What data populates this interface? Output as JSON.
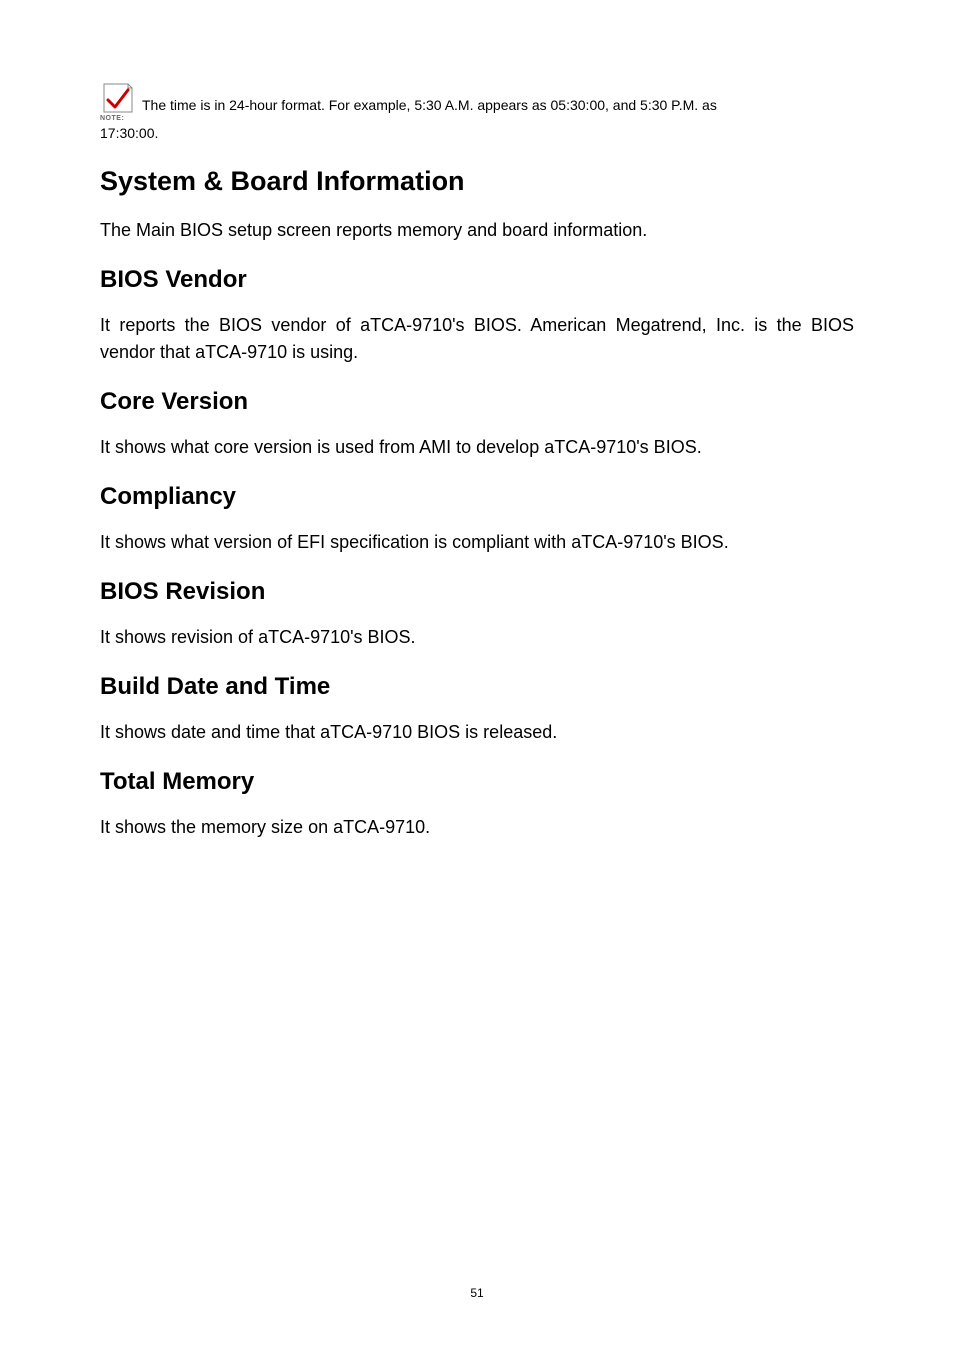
{
  "note": {
    "label": "NOTE:",
    "text_part1": "The time is in 24-hour format. For example, 5:30 A.M. appears as 05:30:00, and 5:30 P.M. as",
    "text_part2": "17:30:00."
  },
  "sections": {
    "h1_1": "System & Board Information",
    "p_1": "The Main BIOS setup screen reports memory and board information.",
    "h2_bios_vendor": "BIOS Vendor",
    "p_bios_vendor": "It reports the BIOS vendor of aTCA-9710's BIOS. American Megatrend, Inc. is the BIOS vendor that aTCA-9710 is using.",
    "h2_core_version": "Core Version",
    "p_core_version": "It shows what core version is used from AMI to develop aTCA-9710's BIOS.",
    "h2_compliancy": "Compliancy",
    "p_compliancy": "It shows what version of EFI specification is compliant with aTCA-9710's BIOS.",
    "h2_bios_revision": "BIOS Revision",
    "p_bios_revision": "It shows revision of aTCA-9710's BIOS.",
    "h2_build_date": "Build Date and Time",
    "p_build_date": "It shows date and time that aTCA-9710 BIOS is released.",
    "h2_total_memory": "Total Memory",
    "p_total_memory": "It shows the memory size on aTCA-9710."
  },
  "page_number": "51"
}
